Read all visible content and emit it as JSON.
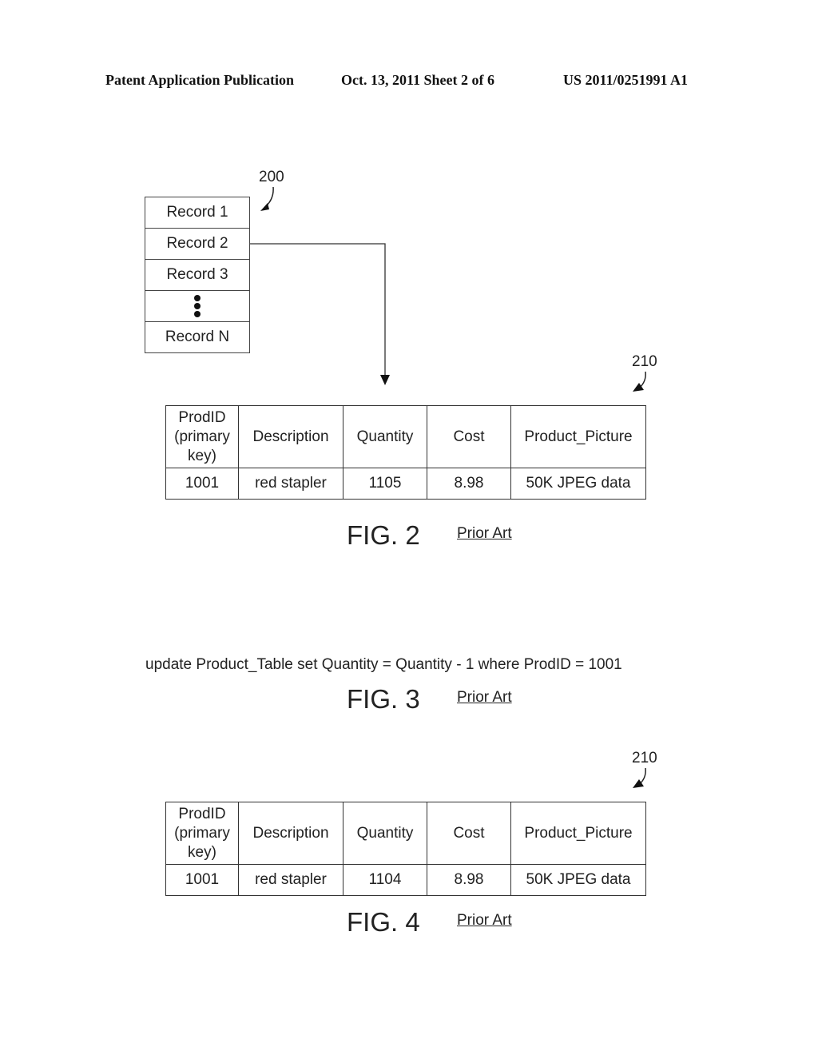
{
  "header": {
    "left": "Patent Application Publication",
    "center": "Oct. 13, 2011   Sheet 2 of 6",
    "right": "US 2011/0251991 A1"
  },
  "fig2": {
    "record_stack_ref": "200",
    "records": [
      "Record 1",
      "Record 2",
      "Record 3",
      "⋮",
      "Record N"
    ],
    "table_ref": "210",
    "table": {
      "headers": [
        "ProdID (primary key)",
        "Description",
        "Quantity",
        "Cost",
        "Product_Picture"
      ],
      "header_lines": [
        [
          "ProdID",
          "(primary",
          "key)"
        ],
        [
          "Description"
        ],
        [
          "Quantity"
        ],
        [
          "Cost"
        ],
        [
          "Product_Picture"
        ]
      ],
      "rows": [
        [
          "1001",
          "red stapler",
          "1105",
          "8.98",
          "50K JPEG data"
        ]
      ]
    },
    "caption": "FIG. 2",
    "note": "Prior Art"
  },
  "fig3": {
    "statement": "update Product_Table set Quantity = Quantity - 1 where ProdID = 1001",
    "caption": "FIG. 3",
    "note": "Prior Art"
  },
  "fig4": {
    "table_ref": "210",
    "table": {
      "headers": [
        "ProdID (primary key)",
        "Description",
        "Quantity",
        "Cost",
        "Product_Picture"
      ],
      "header_lines": [
        [
          "ProdID",
          "(primary",
          "key)"
        ],
        [
          "Description"
        ],
        [
          "Quantity"
        ],
        [
          "Cost"
        ],
        [
          "Product_Picture"
        ]
      ],
      "rows": [
        [
          "1001",
          "red stapler",
          "1104",
          "8.98",
          "50K JPEG data"
        ]
      ]
    },
    "caption": "FIG. 4",
    "note": "Prior Art"
  }
}
